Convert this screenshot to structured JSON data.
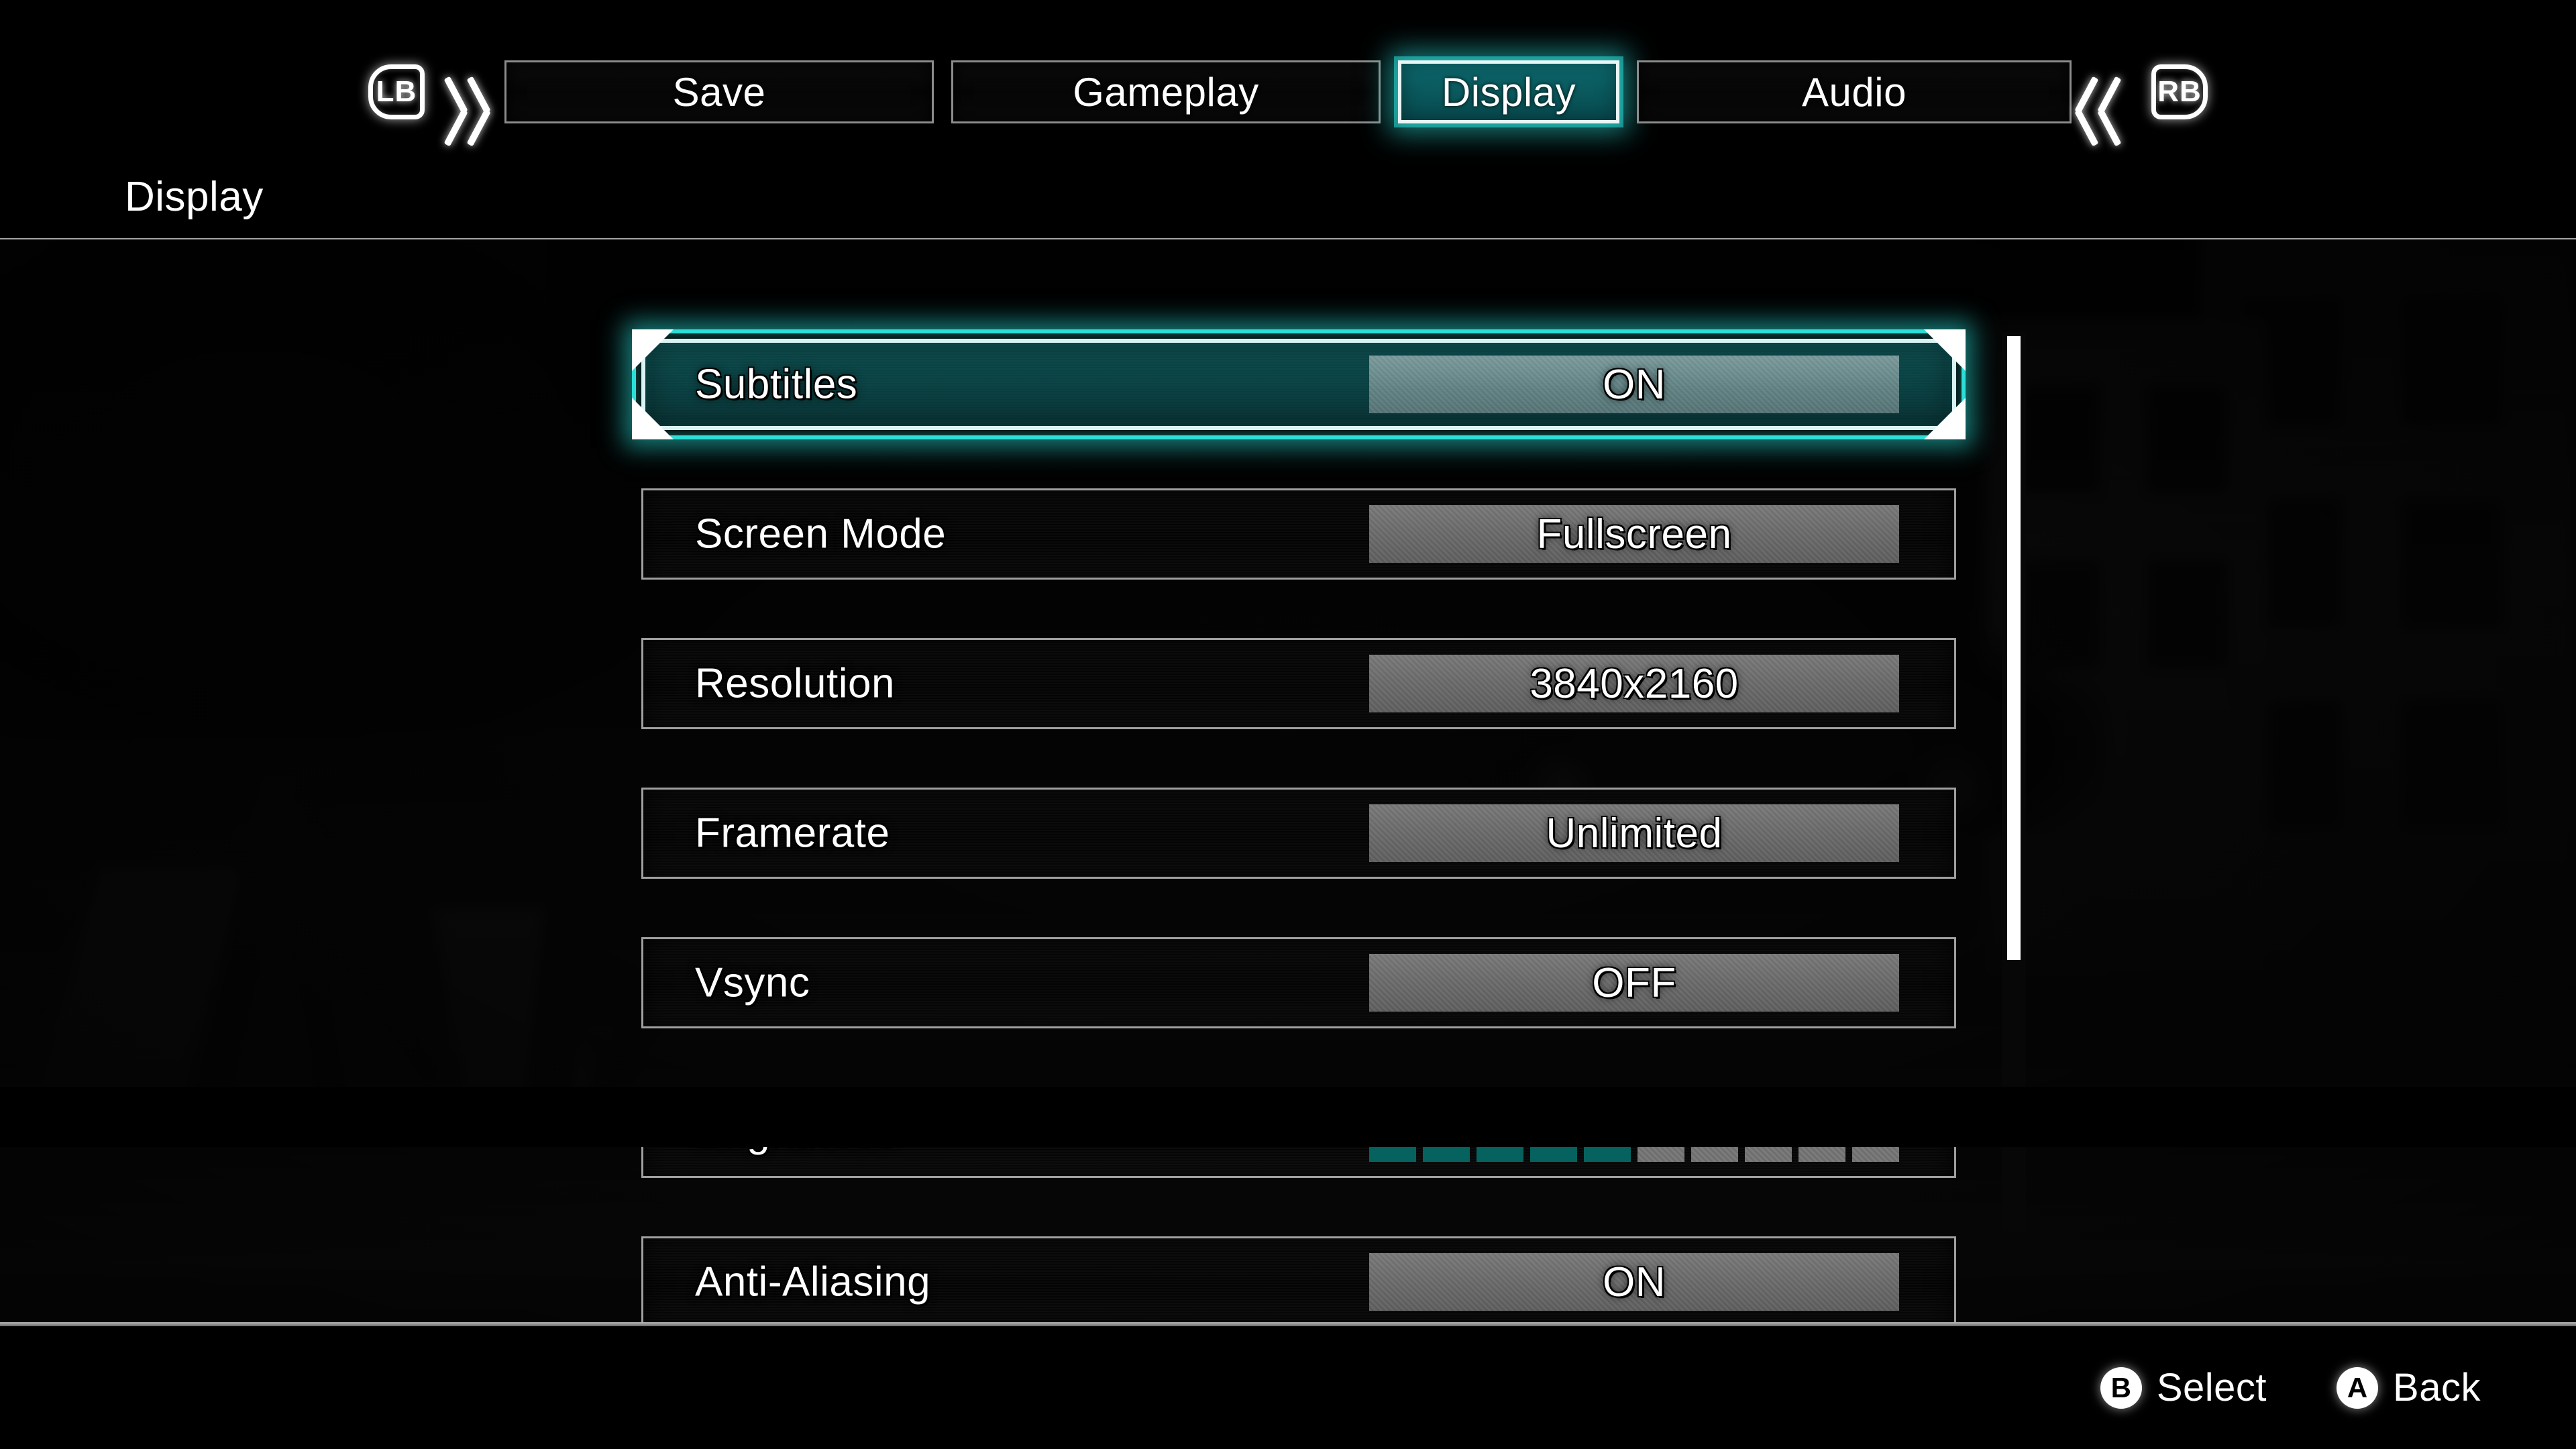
{
  "header": {
    "bumper_left": "LB",
    "bumper_right": "RB",
    "prev_icon": "double-chevron-left-icon",
    "next_icon": "double-chevron-right-icon",
    "tabs": [
      {
        "label": "Save",
        "selected": false
      },
      {
        "label": "Gameplay",
        "selected": false
      },
      {
        "label": "Display",
        "selected": true
      },
      {
        "label": "Audio",
        "selected": false
      }
    ],
    "page_title": "Display"
  },
  "options": [
    {
      "label": "Subtitles",
      "value": "ON",
      "type": "value",
      "selected": true
    },
    {
      "label": "Screen Mode",
      "value": "Fullscreen",
      "type": "value",
      "selected": false
    },
    {
      "label": "Resolution",
      "value": "3840x2160",
      "type": "value",
      "selected": false
    },
    {
      "label": "Framerate",
      "value": "Unlimited",
      "type": "value",
      "selected": false
    },
    {
      "label": "Vsync",
      "value": "OFF",
      "type": "value",
      "selected": false
    },
    {
      "label": "Brightness",
      "value": "",
      "type": "slider",
      "selected": false,
      "slider": {
        "segments": 10,
        "filled": 5
      }
    },
    {
      "label": "Anti-Aliasing",
      "value": "ON",
      "type": "value",
      "selected": false
    }
  ],
  "scrollbar": {
    "thumb_percent": 70
  },
  "footer": {
    "hints": [
      {
        "button": "B",
        "label": "Select"
      },
      {
        "button": "A",
        "label": "Back"
      }
    ]
  },
  "colors": {
    "accent_teal": "#0a5a5e",
    "accent_glow": "#2de6e1",
    "slider_fill": "#05625f",
    "slider_empty": "#747474",
    "value_box": "#6a6a6a",
    "text": "#ffffff",
    "background": "#000000"
  }
}
